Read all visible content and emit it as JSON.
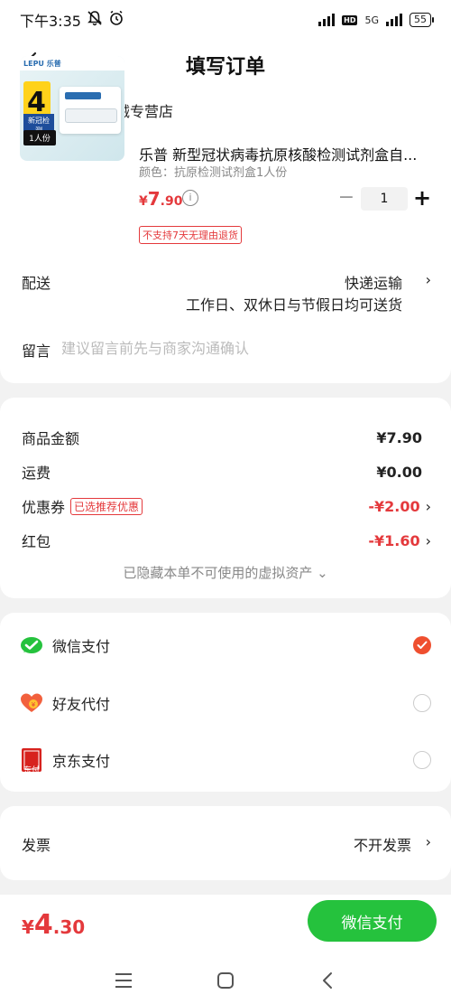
{
  "status_bar": {
    "time": "下午3:35",
    "network": "5G",
    "battery": "55"
  },
  "header": {
    "title": "填写订单"
  },
  "store": {
    "name": "萨埵医疗器械专营店"
  },
  "product": {
    "brand_logo": "LEPU 乐普",
    "image_number": "4",
    "image_label": "新冠检测",
    "image_unit": "1人份",
    "name": "乐普 新型冠状病毒抗原核酸检测试剂盒自...",
    "spec": "颜色：抗原检测试剂盒1人份",
    "price_symbol": "¥",
    "price_int": "7",
    "price_dec": ".90",
    "quantity": "1",
    "return_policy": "不支持7天无理由退货"
  },
  "delivery": {
    "label": "配送",
    "method": "快递运输",
    "note": "工作日、双休日与节假日均可送货"
  },
  "remark": {
    "label": "留言",
    "placeholder": "建议留言前先与商家沟通确认"
  },
  "fees": {
    "goods_label": "商品金额",
    "goods_value": "¥7.90",
    "shipping_label": "运费",
    "shipping_value": "¥0.00",
    "coupon_label": "优惠券",
    "coupon_tag": "已选推荐优惠",
    "coupon_value": "-¥2.00",
    "redpacket_label": "红包",
    "redpacket_value": "-¥1.60",
    "hidden_assets": "已隐藏本单不可使用的虚拟资产"
  },
  "payment": {
    "wechat": "微信支付",
    "friend": "好友代付",
    "jd": "京东支付",
    "jd_icon_text": "东付",
    "selected": "wechat"
  },
  "invoice": {
    "label": "发票",
    "value": "不开发票"
  },
  "footer": {
    "total_symbol": "¥",
    "total_int": "4",
    "total_dec": ".30",
    "pay_button": "微信支付"
  },
  "colors": {
    "accent_red": "#e4393c",
    "wechat_green": "#25c23d",
    "radio_checked": "#ef4f2f"
  }
}
